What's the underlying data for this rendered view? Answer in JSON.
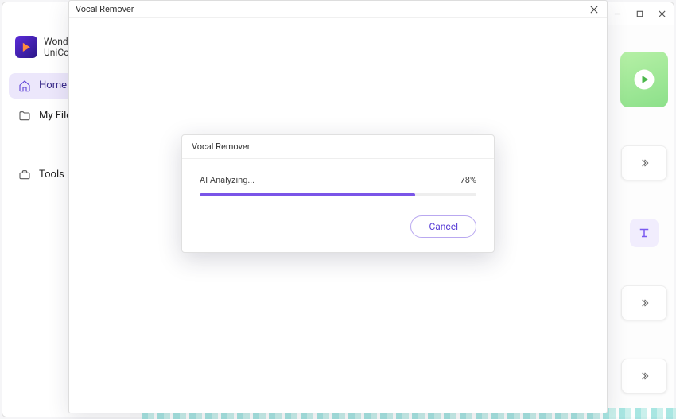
{
  "app": {
    "name_line1": "Wondershare",
    "name_line2": "UniConverter"
  },
  "sidebar": {
    "items": [
      {
        "label": "Home"
      },
      {
        "label": "My Files"
      },
      {
        "label": "Tools"
      }
    ]
  },
  "window_controls": {
    "minimize": "minimize-icon",
    "maximize": "maximize-icon",
    "close": "close-icon"
  },
  "outer_dialog": {
    "title": "Vocal Remover"
  },
  "inner_dialog": {
    "title": "Vocal Remover",
    "status": "AI Analyzing...",
    "percent_label": "78%",
    "percent_value": 78,
    "cancel_label": "Cancel"
  },
  "colors": {
    "accent": "#7a55e8",
    "sidebar_active_bg": "#ece7fb"
  }
}
